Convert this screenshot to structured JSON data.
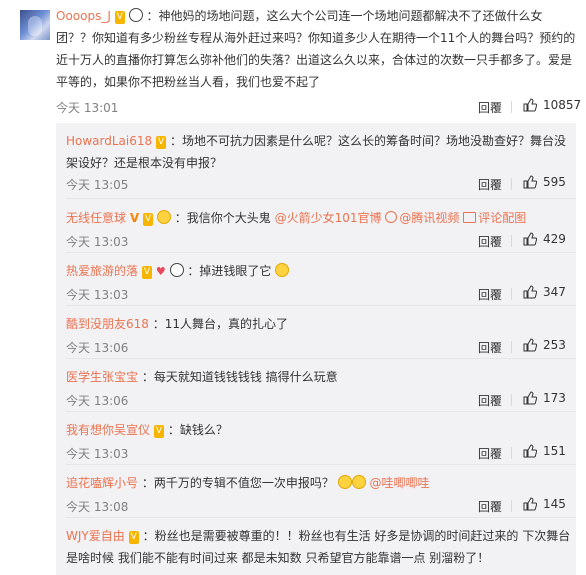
{
  "main": {
    "username": "Oooops_J",
    "text": "：神他妈的场地问题，这么大个公司连一个场地问题都解决不了还做什么女团？？你知道有多少粉丝专程从海外赶过来吗？你知道多少人在期待一个11个人的舞台吗？预约的近十万人的直播你打算怎么弥补他们的失落？出道这么久以来，合体过的次数一只手都多了。爱是平等的，如果你不把粉丝当人看，我们也爱不起了",
    "time": "今天 13:01",
    "reply_label": "回覆",
    "likes": "10857"
  },
  "replies": [
    {
      "username": "HowardLai618",
      "text": "：场地不可抗力因素是什么呢？这么长的筹备时间？场地没勘查好？舞台没架设好？还是根本没有申报？",
      "time": "今天 13:05",
      "reply_label": "回覆",
      "likes": "595"
    },
    {
      "username": "无线任意球",
      "text": "：我信你个大头鬼",
      "mention1": "@火箭少女101官博",
      "mention2": "@腾讯视频",
      "pic_label": "评论配图",
      "time": "今天 13:03",
      "reply_label": "回覆",
      "likes": "429"
    },
    {
      "username": "热爱旅游的落",
      "text": "：掉进钱眼了它",
      "time": "今天 13:03",
      "reply_label": "回覆",
      "likes": "347"
    },
    {
      "username": "酷到没朋友618",
      "text": "：11人舞台，真的扎心了",
      "time": "今天 13:06",
      "reply_label": "回覆",
      "likes": "253"
    },
    {
      "username": "医学生张宝宝",
      "text": "：每天就知道钱钱钱钱 搞得什么玩意",
      "time": "今天 13:06",
      "reply_label": "回覆",
      "likes": "173"
    },
    {
      "username": "我有想你吴宣仪",
      "text": "：缺钱么？",
      "time": "今天 13:03",
      "reply_label": "回覆",
      "likes": "151"
    },
    {
      "username": "追花嗑辉小号",
      "text": "：两千万的专辑不值您一次申报吗？",
      "mention1": "@哇唧唧哇",
      "time": "今天 13:08",
      "reply_label": "回覆",
      "likes": "145"
    },
    {
      "username": "WJY爱自由",
      "text": "：粉丝也是需要被尊重的！！粉丝也有生活 好多是协调的时间赶过来的 下次舞台是啥时候 我们能不能有时间过来 都是未知数 只希望官方能靠谱一点 别溜粉了！",
      "time": "",
      "reply_label": "",
      "likes": ""
    }
  ],
  "icons": {
    "like": "thumb-up-icon",
    "vip": "vip-badge-icon",
    "panda": "panda-emoji",
    "heart": "heart-emoji"
  },
  "colors": {
    "username": "#eb7350",
    "link": "#eb7350",
    "meta": "#808080",
    "reply_bg": "#f2f2f5",
    "accent_vip": "#f7b500"
  }
}
